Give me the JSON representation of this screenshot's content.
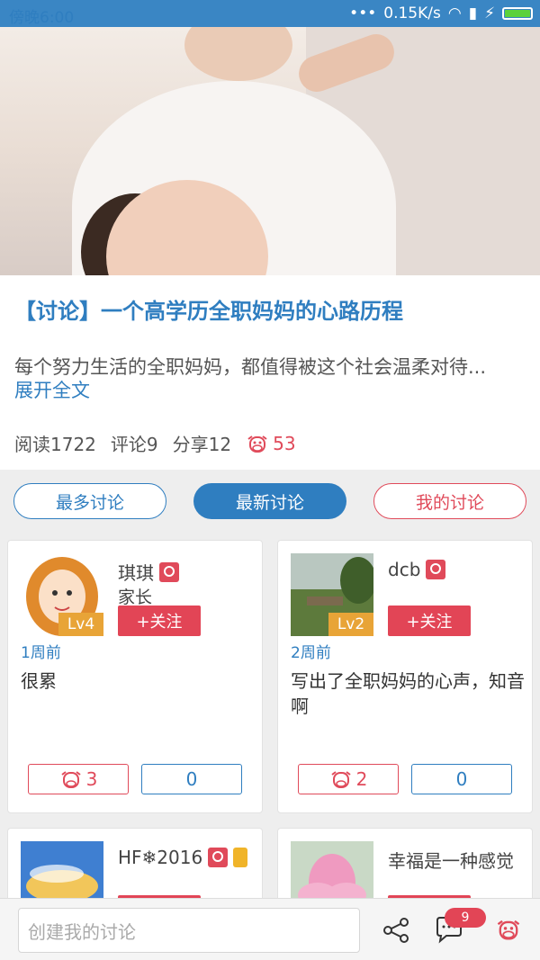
{
  "status_bar": {
    "time": "傍晚6:00",
    "speed": "0.15K/s"
  },
  "article": {
    "title": "【讨论】一个高学历全职妈妈的心路历程",
    "summary": "每个努力生活的全职妈妈，都值得被这个社会温柔对待...",
    "expand": "展开全文",
    "reads": "阅读1722",
    "comments": "评论9",
    "shares": "分享12",
    "likes": "53"
  },
  "tabs": {
    "most": "最多讨论",
    "latest": "最新讨论",
    "mine": "我的讨论"
  },
  "posts": [
    {
      "name": "琪琪",
      "role": "家长",
      "level": "Lv4",
      "follow": "+关注",
      "time": "1周前",
      "content": "很累",
      "likes": "3",
      "comments": "0"
    },
    {
      "name": "dcb",
      "role": "",
      "level": "Lv2",
      "follow": "+关注",
      "time": "2周前",
      "content": "写出了全职妈妈的心声，知音啊",
      "likes": "2",
      "comments": "0"
    },
    {
      "name": "HF❄2016",
      "role": "",
      "level": "",
      "follow": "",
      "time": "",
      "content": "",
      "likes": "",
      "comments": ""
    },
    {
      "name": "幸福是一种感觉",
      "role": "",
      "level": "",
      "follow": "",
      "time": "",
      "content": "",
      "likes": "",
      "comments": ""
    }
  ],
  "bottom_bar": {
    "placeholder": "创建我的讨论",
    "notification_count": "9"
  },
  "colors": {
    "primary": "#2f7ec0",
    "accent": "#e24556",
    "status_bar": "#3a86c4"
  }
}
